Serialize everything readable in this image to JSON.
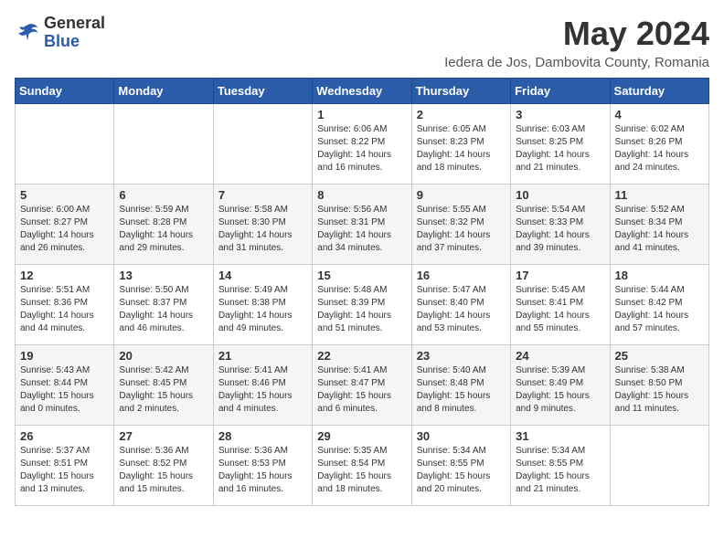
{
  "header": {
    "logo_general": "General",
    "logo_blue": "Blue",
    "month_year": "May 2024",
    "location": "Iedera de Jos, Dambovita County, Romania"
  },
  "days_of_week": [
    "Sunday",
    "Monday",
    "Tuesday",
    "Wednesday",
    "Thursday",
    "Friday",
    "Saturday"
  ],
  "weeks": [
    [
      {
        "day": "",
        "info": ""
      },
      {
        "day": "",
        "info": ""
      },
      {
        "day": "",
        "info": ""
      },
      {
        "day": "1",
        "info": "Sunrise: 6:06 AM\nSunset: 8:22 PM\nDaylight: 14 hours\nand 16 minutes."
      },
      {
        "day": "2",
        "info": "Sunrise: 6:05 AM\nSunset: 8:23 PM\nDaylight: 14 hours\nand 18 minutes."
      },
      {
        "day": "3",
        "info": "Sunrise: 6:03 AM\nSunset: 8:25 PM\nDaylight: 14 hours\nand 21 minutes."
      },
      {
        "day": "4",
        "info": "Sunrise: 6:02 AM\nSunset: 8:26 PM\nDaylight: 14 hours\nand 24 minutes."
      }
    ],
    [
      {
        "day": "5",
        "info": "Sunrise: 6:00 AM\nSunset: 8:27 PM\nDaylight: 14 hours\nand 26 minutes."
      },
      {
        "day": "6",
        "info": "Sunrise: 5:59 AM\nSunset: 8:28 PM\nDaylight: 14 hours\nand 29 minutes."
      },
      {
        "day": "7",
        "info": "Sunrise: 5:58 AM\nSunset: 8:30 PM\nDaylight: 14 hours\nand 31 minutes."
      },
      {
        "day": "8",
        "info": "Sunrise: 5:56 AM\nSunset: 8:31 PM\nDaylight: 14 hours\nand 34 minutes."
      },
      {
        "day": "9",
        "info": "Sunrise: 5:55 AM\nSunset: 8:32 PM\nDaylight: 14 hours\nand 37 minutes."
      },
      {
        "day": "10",
        "info": "Sunrise: 5:54 AM\nSunset: 8:33 PM\nDaylight: 14 hours\nand 39 minutes."
      },
      {
        "day": "11",
        "info": "Sunrise: 5:52 AM\nSunset: 8:34 PM\nDaylight: 14 hours\nand 41 minutes."
      }
    ],
    [
      {
        "day": "12",
        "info": "Sunrise: 5:51 AM\nSunset: 8:36 PM\nDaylight: 14 hours\nand 44 minutes."
      },
      {
        "day": "13",
        "info": "Sunrise: 5:50 AM\nSunset: 8:37 PM\nDaylight: 14 hours\nand 46 minutes."
      },
      {
        "day": "14",
        "info": "Sunrise: 5:49 AM\nSunset: 8:38 PM\nDaylight: 14 hours\nand 49 minutes."
      },
      {
        "day": "15",
        "info": "Sunrise: 5:48 AM\nSunset: 8:39 PM\nDaylight: 14 hours\nand 51 minutes."
      },
      {
        "day": "16",
        "info": "Sunrise: 5:47 AM\nSunset: 8:40 PM\nDaylight: 14 hours\nand 53 minutes."
      },
      {
        "day": "17",
        "info": "Sunrise: 5:45 AM\nSunset: 8:41 PM\nDaylight: 14 hours\nand 55 minutes."
      },
      {
        "day": "18",
        "info": "Sunrise: 5:44 AM\nSunset: 8:42 PM\nDaylight: 14 hours\nand 57 minutes."
      }
    ],
    [
      {
        "day": "19",
        "info": "Sunrise: 5:43 AM\nSunset: 8:44 PM\nDaylight: 15 hours\nand 0 minutes."
      },
      {
        "day": "20",
        "info": "Sunrise: 5:42 AM\nSunset: 8:45 PM\nDaylight: 15 hours\nand 2 minutes."
      },
      {
        "day": "21",
        "info": "Sunrise: 5:41 AM\nSunset: 8:46 PM\nDaylight: 15 hours\nand 4 minutes."
      },
      {
        "day": "22",
        "info": "Sunrise: 5:41 AM\nSunset: 8:47 PM\nDaylight: 15 hours\nand 6 minutes."
      },
      {
        "day": "23",
        "info": "Sunrise: 5:40 AM\nSunset: 8:48 PM\nDaylight: 15 hours\nand 8 minutes."
      },
      {
        "day": "24",
        "info": "Sunrise: 5:39 AM\nSunset: 8:49 PM\nDaylight: 15 hours\nand 9 minutes."
      },
      {
        "day": "25",
        "info": "Sunrise: 5:38 AM\nSunset: 8:50 PM\nDaylight: 15 hours\nand 11 minutes."
      }
    ],
    [
      {
        "day": "26",
        "info": "Sunrise: 5:37 AM\nSunset: 8:51 PM\nDaylight: 15 hours\nand 13 minutes."
      },
      {
        "day": "27",
        "info": "Sunrise: 5:36 AM\nSunset: 8:52 PM\nDaylight: 15 hours\nand 15 minutes."
      },
      {
        "day": "28",
        "info": "Sunrise: 5:36 AM\nSunset: 8:53 PM\nDaylight: 15 hours\nand 16 minutes."
      },
      {
        "day": "29",
        "info": "Sunrise: 5:35 AM\nSunset: 8:54 PM\nDaylight: 15 hours\nand 18 minutes."
      },
      {
        "day": "30",
        "info": "Sunrise: 5:34 AM\nSunset: 8:55 PM\nDaylight: 15 hours\nand 20 minutes."
      },
      {
        "day": "31",
        "info": "Sunrise: 5:34 AM\nSunset: 8:55 PM\nDaylight: 15 hours\nand 21 minutes."
      },
      {
        "day": "",
        "info": ""
      }
    ]
  ]
}
